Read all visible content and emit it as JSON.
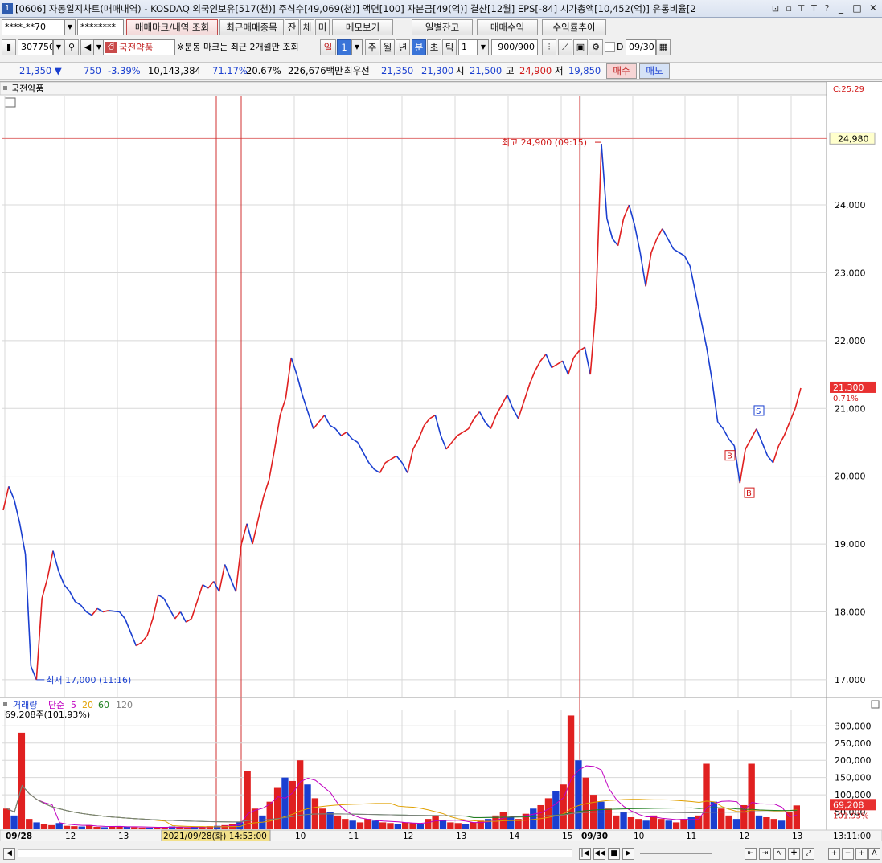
{
  "window": {
    "number": "1",
    "title": "[0606] 자동일지차트(매매내역) - KOSDAQ 외국인보유[517(천)] 주식수[49,069(천)] 액면[100] 자본금[49(억)] 결산[12월] EPS[-84] 시가총액[10,452(억)] 유통비율[2",
    "icons": [
      "window-icon",
      "restore-icon",
      "pin-icon",
      "text-icon",
      "help-icon"
    ],
    "icon_glyphs": [
      "⊡",
      "⧉",
      "⊤",
      "T",
      "?"
    ],
    "controls": [
      "_",
      "□",
      "✕"
    ]
  },
  "toolbar1": {
    "account": "****-**70",
    "password": "********",
    "trade_mark_label": "매매마크/내역 조회",
    "recent_items_label": "최근매매종목",
    "tab_jan": "잔",
    "tab_che": "체",
    "tab_mi": "미",
    "memo_label": "메모보기",
    "daily_balance_label": "일별잔고",
    "trade_profit_label": "매매수익",
    "return_trend_label": "수익률추이"
  },
  "toolbar2": {
    "code": "307750",
    "stock_tag": "경",
    "stock_name": "국전약품",
    "notice": "※분봉 마크는 최근 2개월만 조회",
    "period_il": "일",
    "period_value": "1",
    "period_ju": "주",
    "period_wol": "월",
    "period_nyeon": "년",
    "period_bun": "분",
    "period_cho": "초",
    "period_tick": "틱",
    "interval": "1",
    "count": "900",
    "count_total": "/900",
    "date_checkbox_label": "D",
    "date": "09/30"
  },
  "quote": {
    "price": "21,350",
    "arrow": "▼",
    "change": "750",
    "change_pct": "-3.39%",
    "volume": "10,143,384",
    "vol_ratio": "71.17%",
    "turnover": "20.67%",
    "amount": "226,676백만",
    "priority_label": "최우선",
    "ask": "21,350",
    "bid": "21,300",
    "open_label": "시",
    "open": "21,500",
    "high_label": "고",
    "high": "24,900",
    "low_label": "저",
    "low": "19,850",
    "buy_label": "매수",
    "sell_label": "매도"
  },
  "price_panel": {
    "name": "국전약품",
    "corner_label": "C:25,29",
    "current_tag": "24,980",
    "last_price_tag": "21,300",
    "last_pct_tag": "0.71%",
    "high_annotation": "최고 24,900 (09:15)",
    "low_annotation": "최저 17,000 (11:16)",
    "buy_marker": "B",
    "sell_marker": "S"
  },
  "volume_panel": {
    "label_volume": "거래량",
    "label_ma": "단순",
    "ma_periods": [
      "5",
      "20",
      "60",
      "120"
    ],
    "ma_colors": [
      "#c000c0",
      "#e0a000",
      "#208020",
      "#808080"
    ],
    "summary": "69,208주(101,93%)",
    "last_value_tag": "69,208",
    "last_pct_tag": "101.93%"
  },
  "x_axis": {
    "labels": [
      "09/28",
      "12",
      "13",
      "10",
      "11",
      "12",
      "13",
      "14",
      "15",
      "09/30",
      "10",
      "11",
      "12",
      "13"
    ],
    "cursor_label": "2021/09/28(화) 14:53:00",
    "time_label": "13:11:00"
  },
  "colors": {
    "up": "#e02020",
    "down": "#1a3fd0",
    "grid": "#d8d8d8",
    "vline": "#d03030"
  },
  "chart_data": [
    {
      "type": "line",
      "title": "국전약품",
      "y_ticks": [
        17000,
        18000,
        19000,
        20000,
        21000,
        22000,
        23000,
        24000
      ],
      "y_tick_labels": [
        "17,000",
        "18,000",
        "19,000",
        "20,000",
        "21,000",
        "22,000",
        "23,000",
        "24,000"
      ],
      "ylim": [
        16750,
        25600
      ],
      "x_labels": [
        "09/28",
        "12",
        "13",
        "10",
        "11",
        "12",
        "13",
        "14",
        "15",
        "09/30",
        "10",
        "11",
        "12",
        "13"
      ],
      "series": [
        {
          "values": [
            19500,
            19850,
            19650,
            19300,
            18850,
            17200,
            17000,
            18200,
            18500,
            18900,
            18600,
            18400,
            18300,
            18150,
            18100,
            18000,
            17950,
            18050,
            18000,
            18020,
            18010,
            18000,
            17900,
            17700,
            17500,
            17550,
            17650,
            17900,
            18250,
            18200,
            18050,
            17900,
            18000,
            17850,
            17900,
            18150,
            18400,
            18350,
            18450,
            18300,
            18700,
            18500,
            18300,
            19000,
            19300,
            19000,
            19350,
            19700,
            19950,
            20400,
            20900,
            21150,
            21750,
            21500,
            21200,
            20950,
            20700,
            20800,
            20900,
            20750,
            20700,
            20600,
            20650,
            20550,
            20500,
            20350,
            20200,
            20100,
            20050,
            20200,
            20250,
            20300,
            20200,
            20050,
            20400,
            20550,
            20750,
            20850,
            20900,
            20600,
            20400,
            20500,
            20600,
            20650,
            20700,
            20850,
            20950,
            20800,
            20700,
            20900,
            21050,
            21200,
            21000,
            20850,
            21100,
            21350,
            21550,
            21700,
            21800,
            21600,
            21650,
            21700,
            21500,
            21750,
            21850,
            21900,
            21500,
            22500,
            24900,
            23800,
            23500,
            23400,
            23800,
            24000,
            23700,
            23300,
            22800,
            23300,
            23500,
            23650,
            23500,
            23350,
            23300,
            23250,
            23100,
            22700,
            22300,
            21900,
            21400,
            20800,
            20700,
            20550,
            20450,
            19900,
            20400,
            20550,
            20700,
            20500,
            20300,
            20200,
            20450,
            20600,
            20800,
            21000,
            21300
          ]
        }
      ]
    },
    {
      "type": "bar",
      "title": "거래량",
      "y_ticks": [
        50000,
        100000,
        150000,
        200000,
        250000,
        300000
      ],
      "y_tick_labels": [
        "50,000",
        "100,000",
        "150,000",
        "200,000",
        "250,000",
        "300,000"
      ],
      "ylim": [
        0,
        345000
      ],
      "series": [
        {
          "name": "거래량",
          "values": [
            60000,
            40000,
            280000,
            30000,
            20000,
            15000,
            12000,
            18000,
            10000,
            9000,
            8000,
            12000,
            7000,
            6000,
            8000,
            9000,
            7000,
            6000,
            5000,
            5000,
            6000,
            7000,
            8000,
            6000,
            5000,
            6000,
            7000,
            9000,
            10000,
            12000,
            15000,
            20000,
            170000,
            60000,
            40000,
            80000,
            120000,
            150000,
            140000,
            200000,
            130000,
            90000,
            60000,
            50000,
            40000,
            30000,
            25000,
            20000,
            30000,
            25000,
            20000,
            18000,
            15000,
            20000,
            18000,
            15000,
            30000,
            40000,
            25000,
            20000,
            18000,
            15000,
            20000,
            25000,
            30000,
            40000,
            50000,
            35000,
            30000,
            45000,
            60000,
            70000,
            90000,
            110000,
            130000,
            330000,
            200000,
            150000,
            100000,
            80000,
            60000,
            40000,
            50000,
            35000,
            30000,
            25000,
            40000,
            30000,
            25000,
            20000,
            30000,
            35000,
            40000,
            190000,
            80000,
            60000,
            40000,
            30000,
            70000,
            190000,
            40000,
            35000,
            30000,
            25000,
            50000,
            69208
          ]
        }
      ]
    }
  ]
}
